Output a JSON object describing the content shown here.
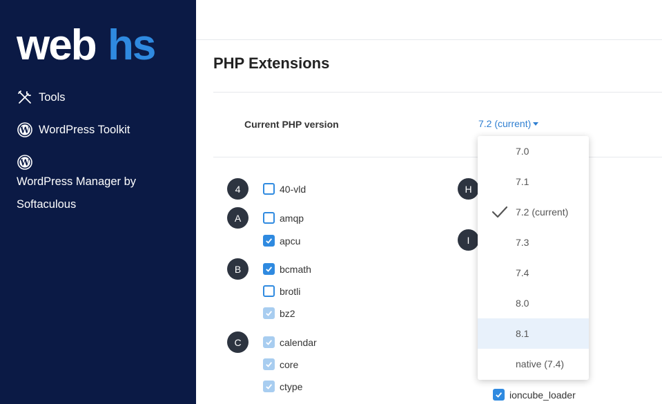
{
  "sidebar": {
    "logo": {
      "text_main": "web",
      "text_accent": "hs",
      "color_main": "#ffffff",
      "color_accent": "#2f8ae0"
    },
    "items": [
      {
        "label": "Tools",
        "icon": "tools-icon"
      },
      {
        "label": "WordPress Toolkit",
        "icon": "wordpress-icon"
      },
      {
        "label": "WordPress Manager by Softaculous",
        "icon": "wordpress-icon"
      }
    ]
  },
  "page": {
    "title": "PHP Extensions",
    "php_version_label": "Current PHP version",
    "php_version_value": "7.2 (current)"
  },
  "badges": [
    "4",
    "A",
    "B",
    "C",
    "H",
    "I"
  ],
  "extensions": [
    {
      "name": "40-vld",
      "state": "unchecked"
    },
    {
      "name": "amqp",
      "state": "unchecked"
    },
    {
      "name": "apcu",
      "state": "checked"
    },
    {
      "name": "bcmath",
      "state": "checked"
    },
    {
      "name": "brotli",
      "state": "unchecked"
    },
    {
      "name": "bz2",
      "state": "disabled"
    },
    {
      "name": "calendar",
      "state": "disabled"
    },
    {
      "name": "core",
      "state": "disabled"
    },
    {
      "name": "ctype",
      "state": "disabled"
    },
    {
      "name": "ioncube_loader",
      "state": "checked"
    }
  ],
  "php_dropdown": {
    "options": [
      "7.0",
      "7.1",
      "7.2 (current)",
      "7.3",
      "7.4",
      "8.0",
      "8.1",
      "native (7.4)"
    ],
    "selected": "7.2 (current)",
    "hovered": "8.1"
  },
  "colors": {
    "sidebar_bg": "#0b1a45",
    "accent": "#2f8ae0",
    "badge_bg": "#2d3440",
    "hover_bg": "#e8f1fb"
  }
}
